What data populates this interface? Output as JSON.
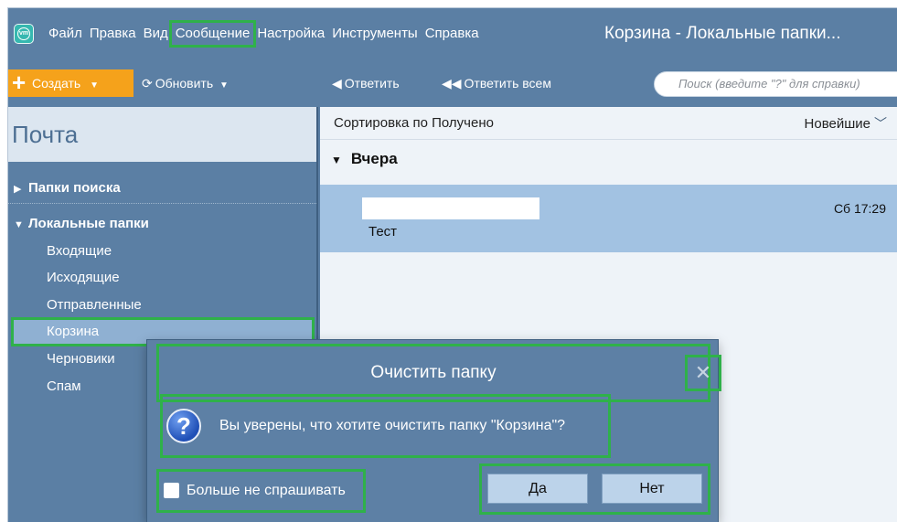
{
  "menu": {
    "items": [
      "Файл",
      "Правка",
      "Вид",
      "Сообщение",
      "Настройка",
      "Инструменты",
      "Справка"
    ],
    "highlighted": "Сообщение"
  },
  "window_title": "Корзина - Локальные папки...",
  "toolbar": {
    "create_label": "Создать",
    "refresh_label": "Обновить",
    "reply_label": "Ответить",
    "reply_all_label": "Ответить всем",
    "search_placeholder": "Поиск (введите \"?\" для справки)"
  },
  "sidebar": {
    "title": "Почта",
    "groups": [
      {
        "label": "Папки поиска",
        "expanded": false
      },
      {
        "label": "Локальные папки",
        "expanded": true
      }
    ],
    "folders": [
      "Входящие",
      "Исходящие",
      "Отправленные",
      "Корзина",
      "Черновики",
      "Спам"
    ],
    "selected_folder": "Корзина"
  },
  "message_list": {
    "sort_label": "Сортировка по Получено",
    "sort_order": "Новейшие",
    "group_label": "Вчера",
    "messages": [
      {
        "subject": "Тест",
        "time": "Сб 17:29"
      }
    ]
  },
  "dialog": {
    "title": "Очистить папку",
    "close_glyph": "✕",
    "message": "Вы уверены, что хотите очистить папку \"Корзина\"?",
    "checkbox_label": "Больше не спрашивать",
    "checkbox_checked": false,
    "yes_label": "Да",
    "no_label": "Нет"
  },
  "colors": {
    "chrome": "#5b7fa4",
    "accent_create": "#f5a21b",
    "highlight_outline": "#2fb14a",
    "selected_folder": "#8fb0d2",
    "selected_message": "#a2c2e2"
  },
  "icons": [
    "app-logo-icon",
    "plus-icon",
    "refresh-icon",
    "reply-icon",
    "reply-all-icon",
    "question-icon",
    "close-icon",
    "chevron-down-icon"
  ]
}
